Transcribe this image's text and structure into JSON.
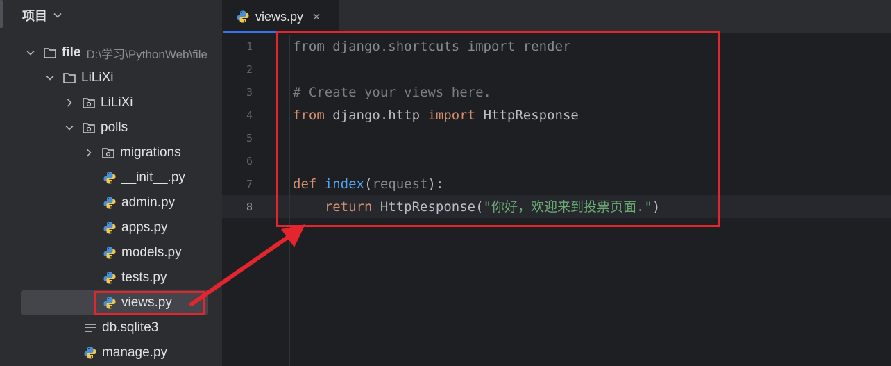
{
  "panel": {
    "title": "项目"
  },
  "tree": [
    {
      "label": "file",
      "path": "D:\\学习\\PythonWeb\\file",
      "type": "root",
      "depth": 0,
      "expanded": true
    },
    {
      "label": "LiLiXi",
      "type": "folder",
      "depth": 1,
      "expanded": true
    },
    {
      "label": "LiLiXi",
      "type": "package",
      "depth": 2,
      "expanded": false
    },
    {
      "label": "polls",
      "type": "package",
      "depth": 2,
      "expanded": true
    },
    {
      "label": "migrations",
      "type": "package",
      "depth": 3,
      "expanded": false
    },
    {
      "label": "__init__.py",
      "type": "python",
      "depth": 3
    },
    {
      "label": "admin.py",
      "type": "python",
      "depth": 3
    },
    {
      "label": "apps.py",
      "type": "python",
      "depth": 3
    },
    {
      "label": "models.py",
      "type": "python",
      "depth": 3
    },
    {
      "label": "tests.py",
      "type": "python",
      "depth": 3
    },
    {
      "label": "views.py",
      "type": "python",
      "depth": 3,
      "selected": true
    },
    {
      "label": "db.sqlite3",
      "type": "text",
      "depth": 2
    },
    {
      "label": "manage.py",
      "type": "python",
      "depth": 2
    }
  ],
  "editor": {
    "tab": {
      "label": "views.py",
      "active": true
    },
    "current_line": 8,
    "line_numbers": [
      "1",
      "2",
      "3",
      "4",
      "5",
      "6",
      "7",
      "8"
    ],
    "code": {
      "l1_from": "from",
      "l1_module": " django.shortcuts ",
      "l1_import": "import",
      "l1_name": " render",
      "l3_comment": "# Create your views here.",
      "l4_from": "from",
      "l4_module": " django.http ",
      "l4_import": "import",
      "l4_name": " HttpResponse",
      "l7_def": "def",
      "l7_fn": " index",
      "l7_open": "(",
      "l7_param": "request",
      "l7_close": "):",
      "l8_indent": "    ",
      "l8_return": "return",
      "l8_call": " HttpResponse(",
      "l8_string": "\"你好，欢迎来到投票页面.\"",
      "l8_close": ")"
    }
  },
  "colors": {
    "annotation": "#e3262d",
    "accent": "#3574f0"
  }
}
